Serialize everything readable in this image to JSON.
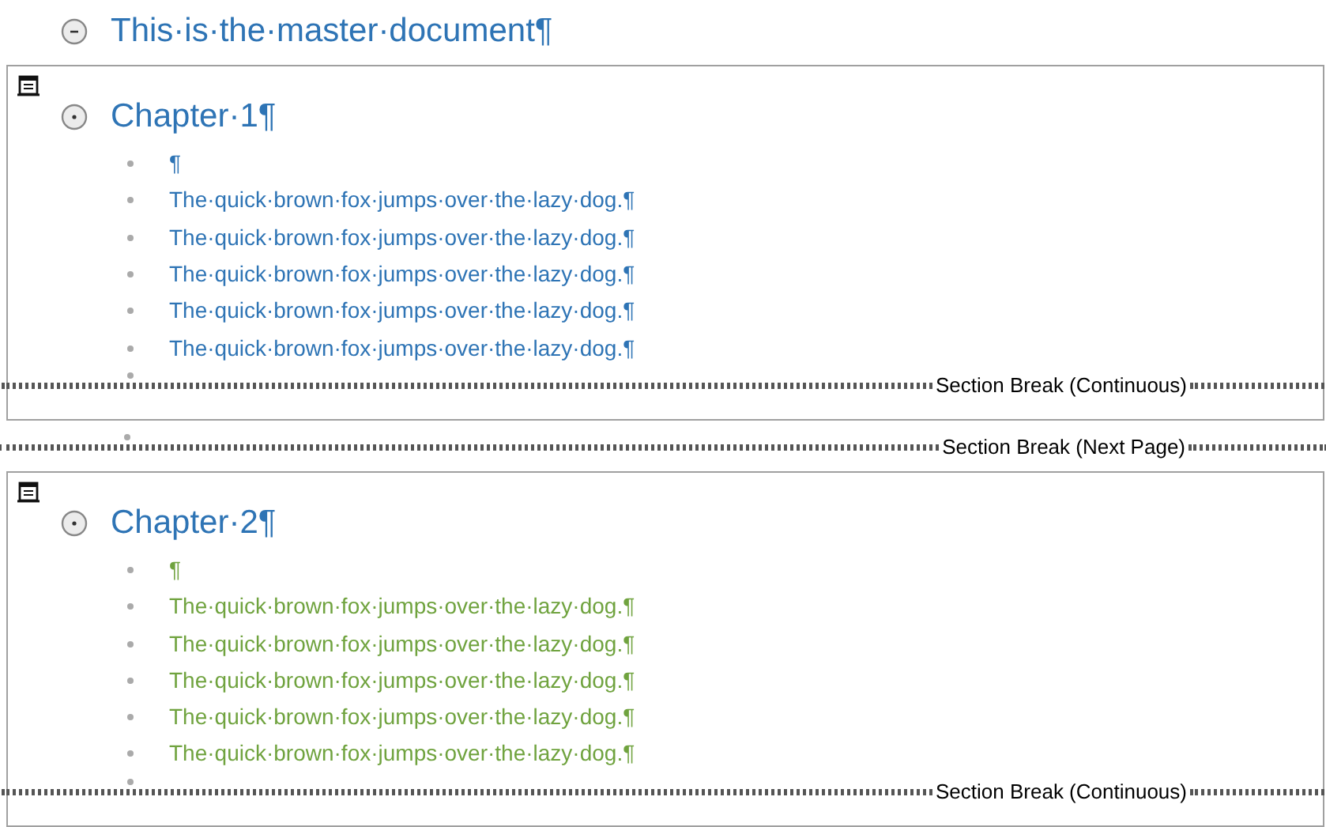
{
  "master_heading": "This·is·the·master·document¶",
  "subdocuments": [
    {
      "heading": "Chapter·1¶",
      "color": "#2e74b5",
      "paragraphs": [
        "¶",
        "The·quick·brown·fox·jumps·over·the·lazy·dog.¶",
        "The·quick·brown·fox·jumps·over·the·lazy·dog.¶",
        "The·quick·brown·fox·jumps·over·the·lazy·dog.¶",
        "The·quick·brown·fox·jumps·over·the·lazy·dog.¶",
        "The·quick·brown·fox·jumps·over·the·lazy·dog.¶"
      ],
      "section_break": "Section Break (Continuous)",
      "following_break": "Section Break (Next Page)"
    },
    {
      "heading": "Chapter·2¶",
      "color": "#70a33f",
      "paragraphs": [
        "¶",
        "The·quick·brown·fox·jumps·over·the·lazy·dog.¶",
        "The·quick·brown·fox·jumps·over·the·lazy·dog.¶",
        "The·quick·brown·fox·jumps·over·the·lazy·dog.¶",
        "The·quick·brown·fox·jumps·over·the·lazy·dog.¶",
        "The·quick·brown·fox·jumps·over·the·lazy·dog.¶"
      ],
      "section_break": "Section Break (Continuous)"
    }
  ]
}
